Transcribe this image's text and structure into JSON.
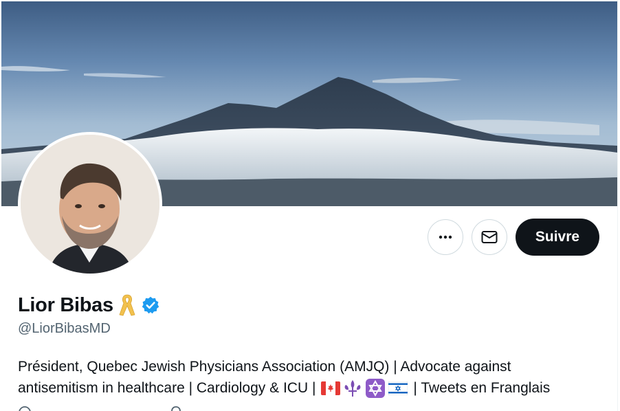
{
  "profile": {
    "display_name": "Lior Bibas",
    "handle": "@LiorBibasMD",
    "bio_line1": "Président, Quebec Jewish Physicians Association (AMJQ) | Advocate against",
    "bio_line2_start": "antisemitism in healthcare | Cardiology & ICU |",
    "bio_line2_end": "| Tweets en Franglais"
  },
  "actions": {
    "follow_label": "Suivre"
  },
  "icons": {
    "more": "more-dots-icon",
    "message": "envelope-icon",
    "ribbon": "yellow-ribbon-icon",
    "verified": "verified-badge-icon",
    "flags": [
      "canada-flag-icon",
      "fleur-de-lis-icon",
      "star-of-david-icon",
      "israel-flag-icon"
    ]
  },
  "colors": {
    "verified": "#1d9bf0",
    "follow_bg": "#0f1419",
    "text_secondary": "#536471",
    "ribbon": "#f2c14e"
  }
}
